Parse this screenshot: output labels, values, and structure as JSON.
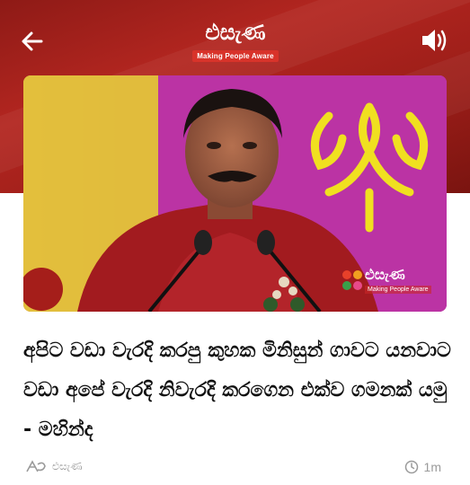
{
  "header": {
    "brand_name": "එසැණ",
    "tagline": "Making People Aware",
    "back_icon": "arrow-left-icon",
    "sound_icon": "speaker-volume-icon",
    "background_color": "#a8221c"
  },
  "article": {
    "image_watermark_brand": "එසැණ",
    "image_watermark_tagline": "Making People Aware",
    "headline": "අපිට වඩා වැරදි කරපු කුහක මිනිසුන් ගාවට යනවාට වඩා අපේ වැරදි නිවැරදි කරගෙන එක්ව ගමනක් යමු - මහින්ද",
    "source_name": "එසැණ",
    "time_ago": "1m"
  }
}
